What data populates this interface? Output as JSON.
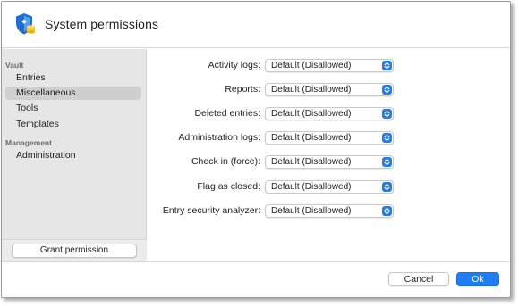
{
  "window": {
    "title": "System permissions",
    "icon": "shield-database-icon"
  },
  "sidebar": {
    "sections": [
      {
        "label": "Vault",
        "items": [
          {
            "label": "Entries",
            "selected": false
          },
          {
            "label": "Miscellaneous",
            "selected": true
          },
          {
            "label": "Tools",
            "selected": false
          },
          {
            "label": "Templates",
            "selected": false
          }
        ]
      },
      {
        "label": "Management",
        "items": [
          {
            "label": "Administration",
            "selected": false
          }
        ]
      }
    ],
    "grant_button": "Grant permission"
  },
  "permissions": [
    {
      "label": "Activity logs:",
      "value": "Default (Disallowed)"
    },
    {
      "label": "Reports:",
      "value": "Default (Disallowed)"
    },
    {
      "label": "Deleted entries:",
      "value": "Default (Disallowed)"
    },
    {
      "label": "Administration logs:",
      "value": "Default (Disallowed)"
    },
    {
      "label": "Check in (force):",
      "value": "Default (Disallowed)"
    },
    {
      "label": "Flag as closed:",
      "value": "Default (Disallowed)"
    },
    {
      "label": "Entry security analyzer:",
      "value": "Default (Disallowed)"
    }
  ],
  "footer": {
    "cancel_label": "Cancel",
    "ok_label": "Ok"
  },
  "colors": {
    "accent": "#1f7cf2",
    "sidebar_bg": "#e6e6e6",
    "selected_bg": "#cfcfcf"
  }
}
